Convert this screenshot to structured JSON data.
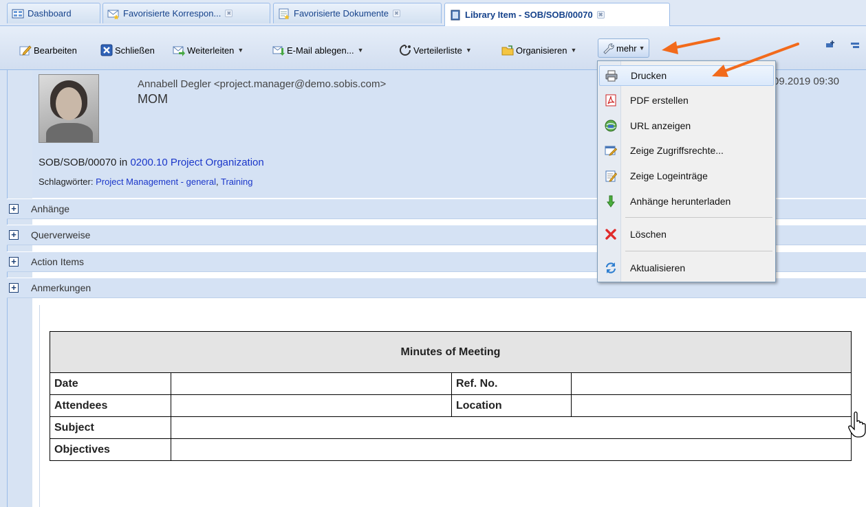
{
  "tabs": [
    {
      "label": "Dashboard"
    },
    {
      "label": "Favorisierte Korrespon..."
    },
    {
      "label": "Favorisierte Dokumente"
    },
    {
      "label": "Library Item - SOB/SOB/00070"
    }
  ],
  "toolbar": {
    "edit_label": "Bearbeiten",
    "close_label": "Schließen",
    "forward_label": "Weiterleiten",
    "email_file_label": "E-Mail ablegen...",
    "distribution_label": "Verteilerliste",
    "organize_label": "Organisieren",
    "more_label": "mehr"
  },
  "header": {
    "sender": "Annabell Degler <project.manager@demo.sobis.com>",
    "subject": "MOM",
    "date_partial": "09.2019 09:30",
    "ref_number": "SOB/SOB/00070",
    "ref_in": "in",
    "ref_folder": "0200.10 Project Organization",
    "tags_label": "Schlagwörter:",
    "tag_1": "Project Management - general",
    "tag_separator": ",",
    "tag_2": "Training"
  },
  "sections": [
    {
      "label": "Anhänge"
    },
    {
      "label": "Querverweise"
    },
    {
      "label": "Action Items"
    },
    {
      "label": "Anmerkungen"
    }
  ],
  "menu": {
    "items": [
      {
        "label": "Drucken",
        "icon": "printer-icon"
      },
      {
        "label": "PDF erstellen",
        "icon": "pdf-icon"
      },
      {
        "label": "URL anzeigen",
        "icon": "globe-icon"
      },
      {
        "label": "Zeige Zugriffsrechte...",
        "icon": "permissions-icon"
      },
      {
        "label": "Zeige Logeinträge",
        "icon": "log-icon"
      },
      {
        "label": "Anhänge herunterladen",
        "icon": "download-icon"
      },
      {
        "label": "Löschen",
        "icon": "delete-icon"
      },
      {
        "label": "Aktualisieren",
        "icon": "refresh-icon"
      }
    ]
  },
  "document": {
    "title": "Minutes of Meeting",
    "date_label": "Date",
    "refno_label": "Ref. No.",
    "attendees_label": "Attendees",
    "location_label": "Location",
    "subject_label": "Subject",
    "objectives_label": "Objectives"
  },
  "colors": {
    "accent": "#15428b",
    "link": "#1a36c9",
    "arrow": "#f26a1b",
    "panel": "#d5e2f4"
  }
}
